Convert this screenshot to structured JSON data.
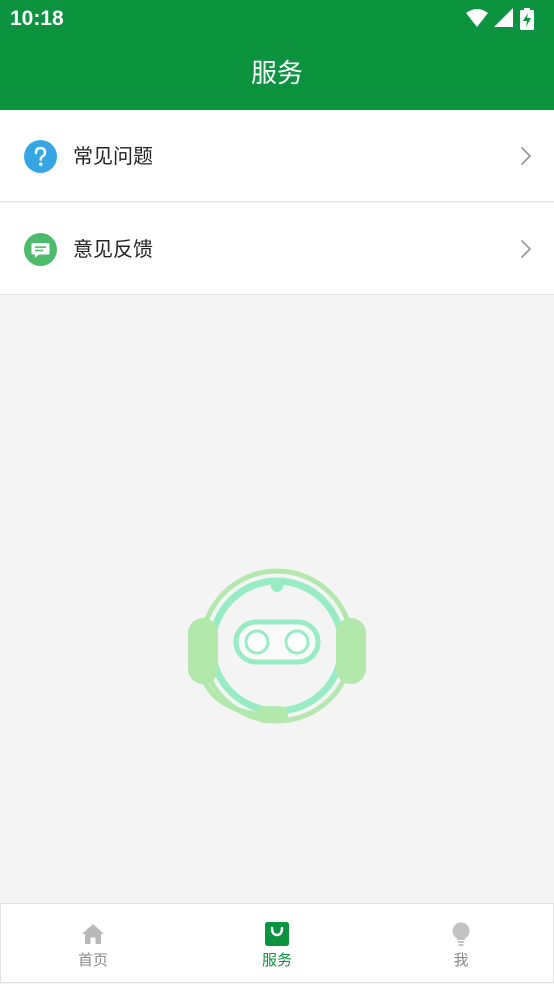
{
  "status_bar": {
    "time": "10:18",
    "icons": [
      "wifi-icon",
      "cellular-signal-icon",
      "battery-charging-icon"
    ]
  },
  "header": {
    "title": "服务"
  },
  "menu": {
    "items": [
      {
        "label": "常见问题",
        "icon": "question-circle-icon",
        "icon_color": "#35a6e3"
      },
      {
        "label": "意见反馈",
        "icon": "feedback-message-icon",
        "icon_color": "#4cbb6c"
      }
    ]
  },
  "illustration": {
    "name": "customer-service-robot-icon"
  },
  "bottom_nav": {
    "items": [
      {
        "label": "首页",
        "icon": "home-icon",
        "active": false
      },
      {
        "label": "服务",
        "icon": "service-bag-icon",
        "active": true
      },
      {
        "label": "我",
        "icon": "lightbulb-icon",
        "active": false
      }
    ]
  },
  "colors": {
    "brand": "#0c9340",
    "background": "#f4f4f4",
    "inactive_tab": "#8a8a8a"
  }
}
